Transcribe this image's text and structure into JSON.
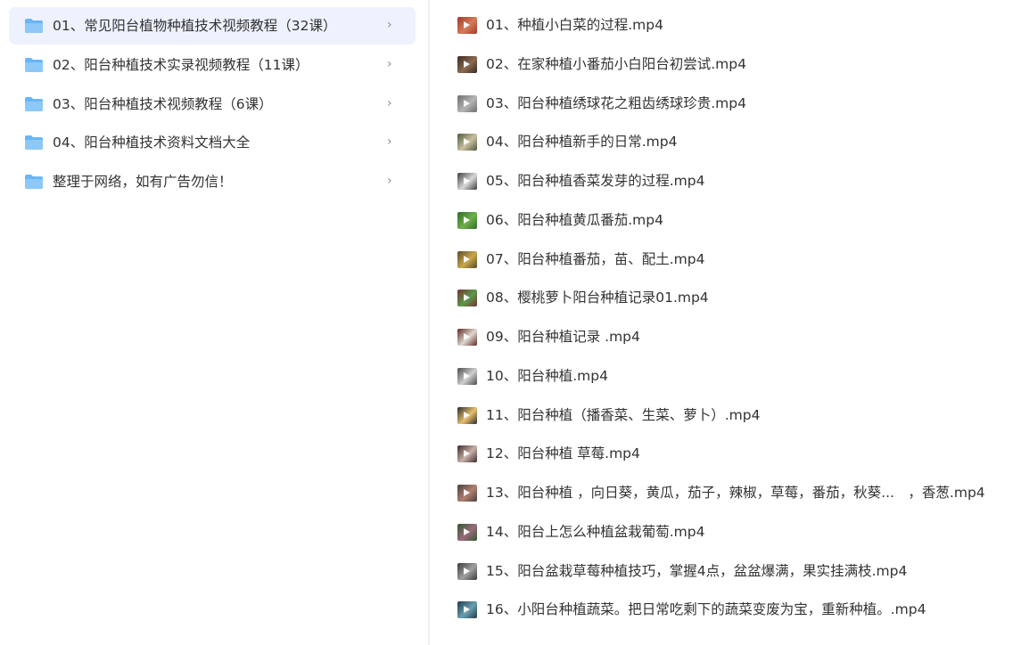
{
  "folders": {
    "items": [
      {
        "label": "01、常见阳台植物种植技术视频教程（32课）",
        "selected": true
      },
      {
        "label": "02、阳台种植技术实录视频教程（11课）",
        "selected": false
      },
      {
        "label": "03、阳台种植技术视频教程（6课）",
        "selected": false
      },
      {
        "label": "04、阳台种植技术资料文档大全",
        "selected": false
      },
      {
        "label": "整理于网络，如有广告勿信！",
        "selected": false
      }
    ],
    "chevron": "›",
    "icon": "folder-icon",
    "icon_color": "#69b6f5"
  },
  "files": {
    "icon": "video-thumbnail-icon",
    "items": [
      {
        "label": "01、种植小白菜的过程.mp4",
        "thumb": [
          "#a03a2c",
          "#d47b5a"
        ]
      },
      {
        "label": "02、在家种植小番茄小白阳台初尝试.mp4",
        "thumb": [
          "#3a2a22",
          "#8a6a50"
        ]
      },
      {
        "label": "03、阳台种植绣球花之粗齿绣球珍贵.mp4",
        "thumb": [
          "#6d6d6d",
          "#b5b5b5"
        ]
      },
      {
        "label": "04、阳台种植新手的日常.mp4",
        "thumb": [
          "#4d5a3a",
          "#c9c0a0"
        ]
      },
      {
        "label": "05、阳台种植香菜发芽的过程.mp4",
        "thumb": [
          "#3c3c3c",
          "#d9d9d9"
        ]
      },
      {
        "label": "06、阳台种植黄瓜番茄.mp4",
        "thumb": [
          "#2f6b2a",
          "#6fb04a"
        ]
      },
      {
        "label": "07、阳台种植番茄，苗、配土.mp4",
        "thumb": [
          "#5a4a2a",
          "#c9a84a"
        ]
      },
      {
        "label": "08、樱桃萝卜阳台种植记录01.mp4",
        "thumb": [
          "#7a3030",
          "#5a9a4a"
        ]
      },
      {
        "label": "09、阳台种植记录 .mp4",
        "thumb": [
          "#5a2a20",
          "#e0d8d0"
        ]
      },
      {
        "label": "10、阳台种植.mp4",
        "thumb": [
          "#4a4a4a",
          "#cfcfcf"
        ]
      },
      {
        "label": "11、阳台种植（播香菜、生菜、萝卜）.mp4",
        "thumb": [
          "#2a2a2a",
          "#e8c070"
        ]
      },
      {
        "label": "12、阳台种植 草莓.mp4",
        "thumb": [
          "#3a2a2a",
          "#c9b0a8"
        ]
      },
      {
        "label": "13、阳台种植 ，向日葵，黄瓜，茄子，辣椒，草莓，番茄，秋葵...　，香葱.mp4",
        "thumb": [
          "#4a4040",
          "#b08070"
        ]
      },
      {
        "label": "14、阳台上怎么种植盆栽葡萄.mp4",
        "thumb": [
          "#2f5a2f",
          "#9a6a7a"
        ]
      },
      {
        "label": "15、阳台盆栽草莓种植技巧，掌握4点，盆盆爆满，果实挂满枝.mp4",
        "thumb": [
          "#3a3a3a",
          "#a0a0a0"
        ]
      },
      {
        "label": "16、小阳台种植蔬菜。把日常吃剩下的蔬菜变废为宝，重新种植。.mp4",
        "thumb": [
          "#1f3a4a",
          "#6aa0b0"
        ]
      }
    ]
  }
}
